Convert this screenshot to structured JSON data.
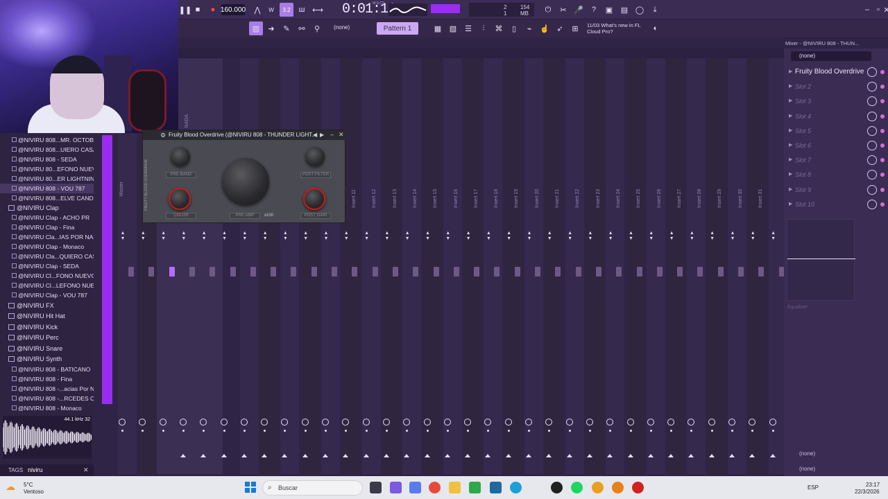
{
  "toolbar": {
    "tempo": "160.000",
    "time": "0:01:11",
    "time_unit": "M:S:CS",
    "song_pos_a": "2",
    "song_pos_b": "1",
    "memory": "154 MB",
    "pattern": "Pattern 1",
    "snap": "(none)",
    "news_date": "11/03",
    "news_title": "What's new in FL",
    "news_sub": "Cloud Pro?",
    "step_label": "3.2"
  },
  "browser": {
    "items_top": [
      "@NIVIRU 808...MR. OCTOBER",
      "@NIVIRU 808...UIERO CASAR",
      "@NIVIRU 808 - SEDA",
      "@NIVIRU 80...EFONO NUEVO",
      "@NIVIRU 80...ER LIGHTNING",
      "@NIVIRU 808 - VOU 787",
      "@NIVIRU 808...ELVE CANDY B"
    ],
    "clap_folder": "@NIVIRU Clap",
    "clap_items": [
      "@NIVIRU Clap - ACHO PR",
      "@NIVIRU Clap - Fina",
      "@NIVIRU Cla...IAS POR NADA",
      "@NIVIRU Clap - Monaco",
      "@NIVIRU Cla...QUIERO CASAR",
      "@NIVIRU Clap - SEDA",
      "@NIVIRU Cl...FONO NUEVO 2",
      "@NIVIRU Cl...LEFONO NUEVO",
      "@NIVIRU Clap - VOU 787"
    ],
    "folders": [
      "@NIVIRU FX",
      "@NIVIRU Hit Hat",
      "@NIVIRU Kick",
      "@NIVIRU Perc",
      "@NIVIRU Snare",
      "@NIVIRU Synth"
    ],
    "bottom_items": [
      "@NIVIRU 808 - BATICANO",
      "@NIVIRU 808 - Fina",
      "@NIVIRU 808 -...acias Por Nada",
      "@NIVIRU 808 -...RCEDES CAROL",
      "@NIVIRU 808 - Monaco"
    ],
    "sample_info": "44.1 kHz 32",
    "tags_label": "TAGS",
    "search_value": "niviru"
  },
  "plugin": {
    "title": "Fruity Blood Overdrive (@NIVIRU 808 - THUNDER LIGHT...",
    "side_label": "FRUITY BLOOD OVERDRIVE",
    "knob_pre_band": "PRE BAND",
    "knob_color": "COLOR",
    "knob_pre_amp": "PRE AMP",
    "knob_x100": "x100",
    "knob_post_filter": "POST FILTER",
    "knob_post_gain": "POST GAIN"
  },
  "mixer": {
    "master_label": "Master",
    "inserts": [
      "Insert 11",
      "Insert 12",
      "Insert 13",
      "Insert 14",
      "Insert 15",
      "Insert 16",
      "Insert 17",
      "Insert 18",
      "Insert 19",
      "Insert 20",
      "Insert 21",
      "Insert 22",
      "Insert 23",
      "Insert 24",
      "Insert 25",
      "Insert 26",
      "Insert 27",
      "Insert 28",
      "Insert 29",
      "Insert 30",
      "Insert 31"
    ],
    "nada_label": "NADA"
  },
  "mixer_panel": {
    "title": "Mixer - @NIVIRU 808 - THUN...",
    "input": "(none)",
    "slots": [
      "Fruity Blood Overdrive",
      "Slot 2",
      "Slot 3",
      "Slot 4",
      "Slot 5",
      "Slot 6",
      "Slot 7",
      "Slot 8",
      "Slot 9",
      "Slot 10"
    ],
    "eq_label": "Equalizer",
    "output_a": "(none)",
    "output_b": "(none)"
  },
  "taskbar": {
    "weather_temp": "5°C",
    "weather_desc": "Ventoso",
    "search_placeholder": "Buscar",
    "lang": "ESP",
    "time": "23:17",
    "date": "22/3/2026"
  }
}
